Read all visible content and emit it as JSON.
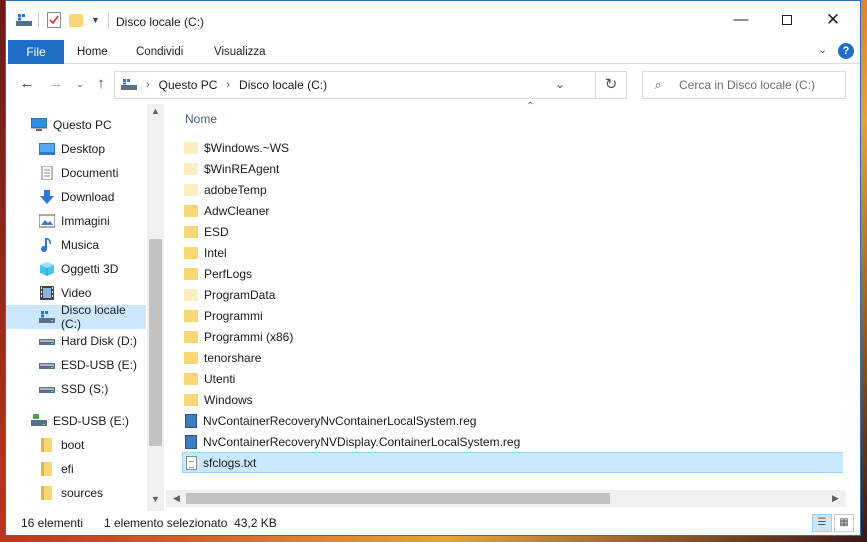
{
  "window": {
    "title": "Disco locale (C:)",
    "minimize_icon": "minimize-icon",
    "maximize_icon": "maximize-icon",
    "close_icon": "close-icon"
  },
  "ribbon": {
    "tabs": [
      {
        "label": "File"
      },
      {
        "label": "Home"
      },
      {
        "label": "Condividi"
      },
      {
        "label": "Visualizza"
      }
    ],
    "help": "?"
  },
  "navbar": {
    "breadcrumb": [
      "Questo PC",
      "Disco locale (C:)"
    ],
    "search_placeholder": "Cerca in Disco locale (C:)"
  },
  "sidebar": {
    "items": [
      {
        "label": "Questo PC",
        "icon": "computer-icon"
      },
      {
        "label": "Desktop",
        "icon": "desktop-icon"
      },
      {
        "label": "Documenti",
        "icon": "documents-icon"
      },
      {
        "label": "Download",
        "icon": "download-icon"
      },
      {
        "label": "Immagini",
        "icon": "pictures-icon"
      },
      {
        "label": "Musica",
        "icon": "music-icon"
      },
      {
        "label": "Oggetti 3D",
        "icon": "3d-objects-icon"
      },
      {
        "label": "Video",
        "icon": "video-icon"
      },
      {
        "label": "Disco locale (C:)",
        "icon": "local-disk-icon",
        "selected": true
      },
      {
        "label": "Hard Disk (D:)",
        "icon": "drive-icon"
      },
      {
        "label": "ESD-USB (E:)",
        "icon": "drive-icon"
      },
      {
        "label": "SSD  (S:)",
        "icon": "drive-icon"
      },
      {
        "label": "ESD-USB (E:)",
        "icon": "usb-drive-icon"
      },
      {
        "label": "boot",
        "icon": "folder-icon"
      },
      {
        "label": "efi",
        "icon": "folder-icon"
      },
      {
        "label": "sources",
        "icon": "folder-icon"
      }
    ]
  },
  "files": {
    "column_header": "Nome",
    "rows": [
      {
        "name": "$Windows.~WS",
        "type": "folder-faded"
      },
      {
        "name": "$WinREAgent",
        "type": "folder-faded"
      },
      {
        "name": "adobeTemp",
        "type": "folder-faded"
      },
      {
        "name": "AdwCleaner",
        "type": "folder"
      },
      {
        "name": "ESD",
        "type": "folder"
      },
      {
        "name": "Intel",
        "type": "folder"
      },
      {
        "name": "PerfLogs",
        "type": "folder"
      },
      {
        "name": "ProgramData",
        "type": "folder-faded"
      },
      {
        "name": "Programmi",
        "type": "folder"
      },
      {
        "name": "Programmi (x86)",
        "type": "folder"
      },
      {
        "name": "tenorshare",
        "type": "folder"
      },
      {
        "name": "Utenti",
        "type": "folder"
      },
      {
        "name": "Windows",
        "type": "folder"
      },
      {
        "name": "NvContainerRecoveryNvContainerLocalSystem.reg",
        "type": "reg"
      },
      {
        "name": "NvContainerRecoveryNVDisplay.ContainerLocalSystem.reg",
        "type": "reg"
      },
      {
        "name": "sfclogs.txt",
        "type": "txt",
        "selected": true
      }
    ]
  },
  "status": {
    "count": "16 elementi",
    "selection": "1 elemento selezionato  43,2 KB"
  },
  "colors": {
    "accent": "#1e6ec8",
    "selection": "#cce8ff",
    "folder": "#f8d775",
    "folder_faded": "#fcecc0"
  }
}
